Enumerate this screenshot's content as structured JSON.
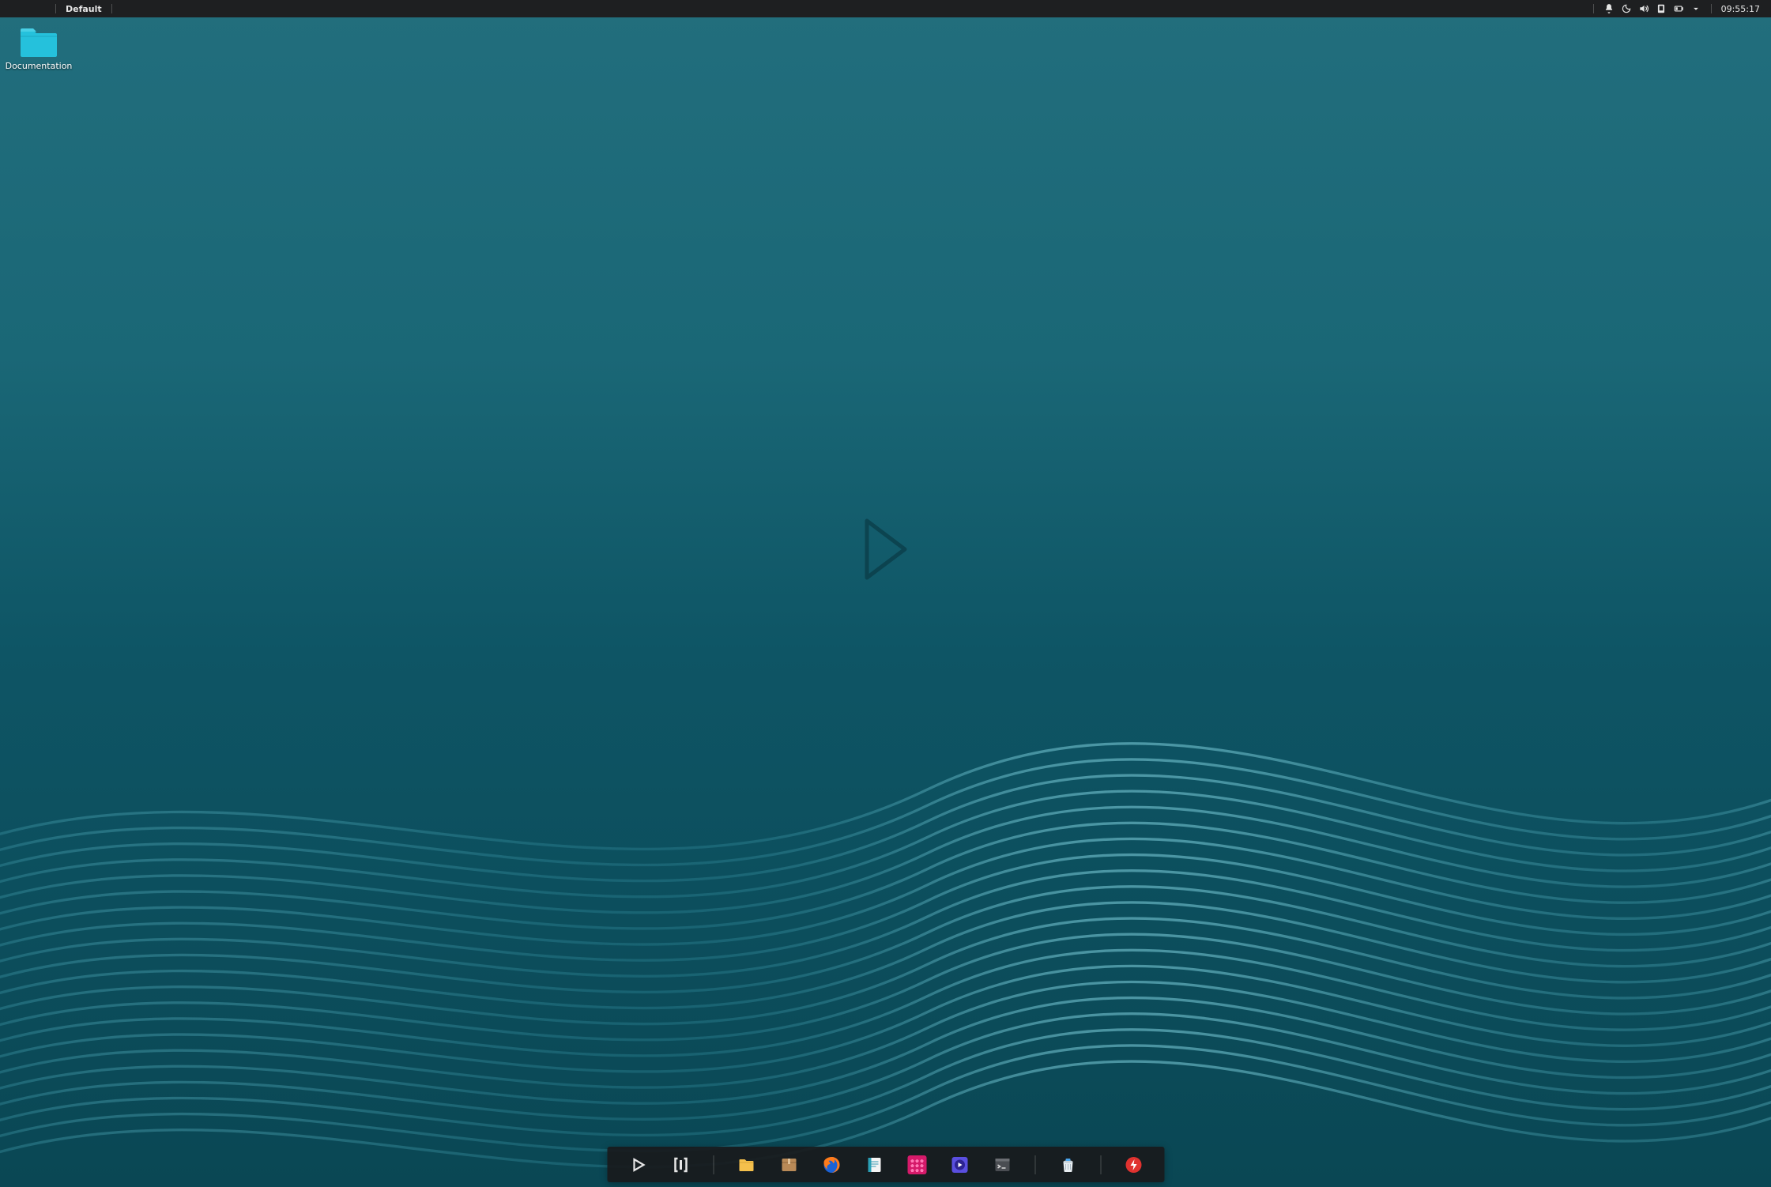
{
  "panel": {
    "workspace": "Default",
    "clock": "09:55:17",
    "tray": [
      {
        "name": "notifications"
      },
      {
        "name": "night-light"
      },
      {
        "name": "volume"
      },
      {
        "name": "network"
      },
      {
        "name": "battery"
      },
      {
        "name": "expand"
      }
    ]
  },
  "desktop": {
    "icons": [
      {
        "name": "documentation",
        "label": "Documentation",
        "type": "folder"
      }
    ]
  },
  "dock": {
    "group1": [
      {
        "name": "applications",
        "icon": "play"
      },
      {
        "name": "workspaces",
        "icon": "brackets"
      }
    ],
    "group2": [
      {
        "name": "file-manager",
        "icon": "folder"
      },
      {
        "name": "archive-manager",
        "icon": "package"
      },
      {
        "name": "firefox",
        "icon": "firefox"
      },
      {
        "name": "text-editor",
        "icon": "notepad"
      },
      {
        "name": "music-player",
        "icon": "music"
      },
      {
        "name": "media-player",
        "icon": "media"
      },
      {
        "name": "terminal",
        "icon": "terminal"
      }
    ],
    "group3": [
      {
        "name": "trash",
        "icon": "trash"
      }
    ],
    "group4": [
      {
        "name": "power",
        "icon": "power"
      }
    ]
  },
  "colors": {
    "accent": "#25c1dc",
    "panel": "#1e1f21"
  }
}
